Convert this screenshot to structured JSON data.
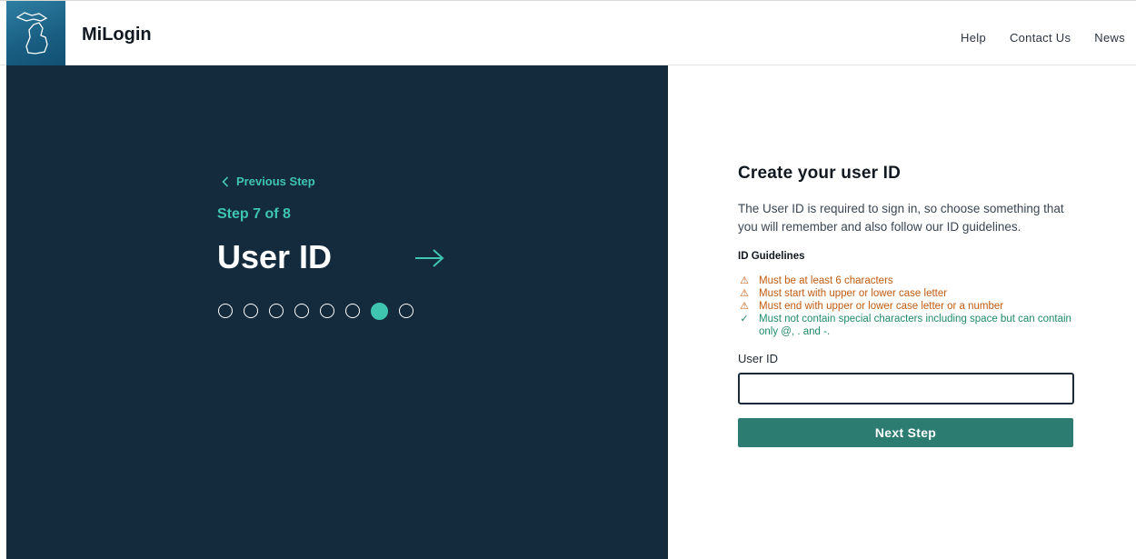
{
  "header": {
    "brand": "MiLogin",
    "nav": [
      "Help",
      "Contact Us",
      "News"
    ]
  },
  "left_panel": {
    "previous_step": "Previous Step",
    "step_indicator": "Step 7 of 8",
    "title": "User ID",
    "progress": {
      "total_steps": 8,
      "current_step": 7
    }
  },
  "form": {
    "heading": "Create your user ID",
    "description": "The User ID is required to sign in, so choose something that you will remember and also follow our ID guidelines.",
    "guidelines_title": "ID Guidelines",
    "guidelines": [
      {
        "status": "warning",
        "text": "Must be at least 6 characters"
      },
      {
        "status": "warning",
        "text": "Must start with upper or lower case letter"
      },
      {
        "status": "warning",
        "text": "Must end with upper or lower case letter or a number"
      },
      {
        "status": "ok",
        "text": "Must not contain special characters including space but can contain only @, . and -."
      }
    ],
    "field_label": "User ID",
    "field_value": "",
    "submit_label": "Next Step"
  },
  "colors": {
    "panel_bg": "#132b3d",
    "accent": "#3fc4b0",
    "button": "#2c7c72",
    "warning": "#c05b10",
    "ok": "#1f8a6a"
  }
}
